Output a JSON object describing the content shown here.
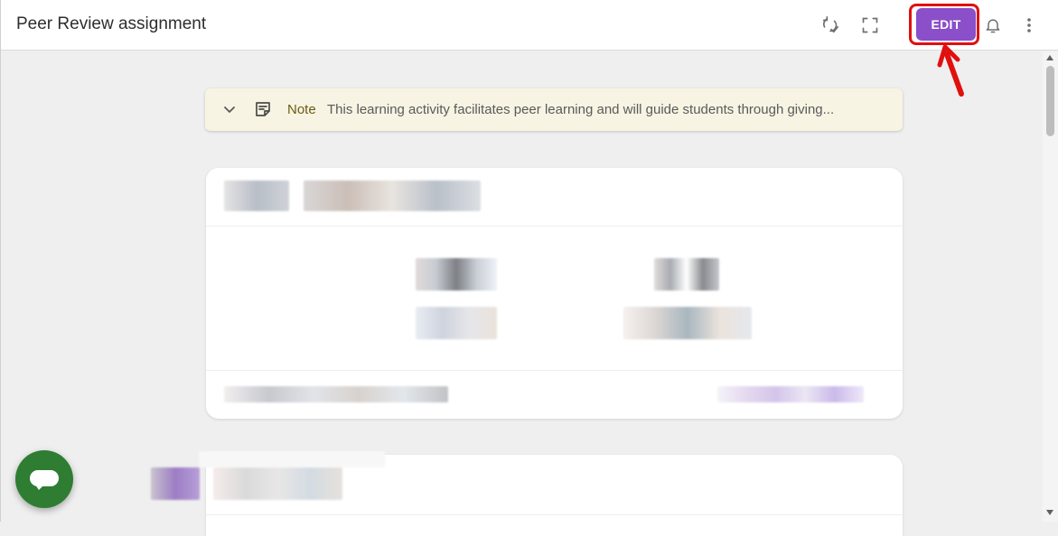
{
  "header": {
    "title": "Peer Review assignment",
    "edit_label": "EDIT",
    "icons": [
      "sync-check-icon",
      "fullscreen-icon",
      "bell-icon",
      "more-vert-icon"
    ]
  },
  "note": {
    "label": "Note",
    "text": "This learning activity facilitates peer learning and will guide students through giving..."
  },
  "colors": {
    "accent": "#8a4fc9",
    "highlight": "#e01010",
    "fab": "#2e7d32",
    "note_bg": "#f7f4e3"
  }
}
